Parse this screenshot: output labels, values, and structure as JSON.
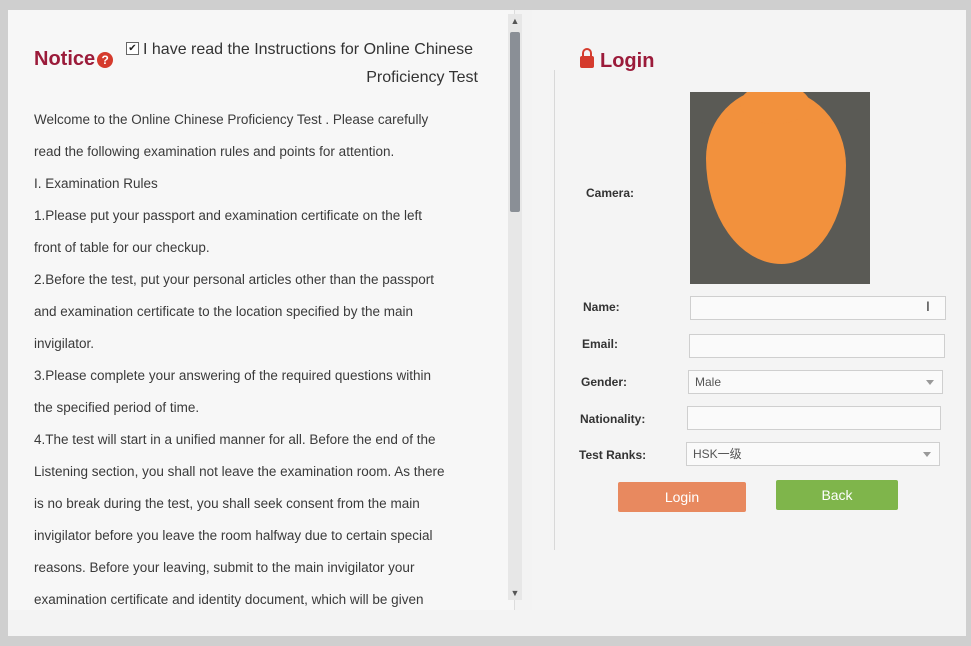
{
  "notice": {
    "title": "Notice",
    "agree_line1": "I have read the Instructions for Online Chinese",
    "agree_line2": "Proficiency Test",
    "agree_checked": true
  },
  "rules": [
    "Welcome to the Online Chinese Proficiency Test . Please carefully",
    "read the following examination rules and points for attention.",
    "I. Examination Rules",
    "1.Please put your passport and examination certificate on the left",
    "front of table for our checkup.",
    "2.Before the test, put your personal articles other than the passport",
    "and examination certificate to the location specified by the main",
    "invigilator.",
    "3.Please complete your answering of the required questions within",
    "the specified period of time.",
    "4.The test will start in a unified manner for all. Before the end of the",
    "Listening section, you shall not leave the examination room. As there",
    "is no break during the test, you shall seek consent from the main",
    "invigilator before you leave the room halfway due to certain special",
    "reasons. Before your leaving, submit to the main invigilator your",
    "examination certificate and identity document, which will be given"
  ],
  "login": {
    "title": "Login",
    "labels": {
      "camera": "Camera:",
      "name": "Name:",
      "email": "Email:",
      "gender": "Gender:",
      "nationality": "Nationality:",
      "test_ranks": "Test Ranks:"
    },
    "values": {
      "name": "",
      "email": "",
      "gender": "Male",
      "nationality": "",
      "test_ranks": "HSK一级"
    },
    "buttons": {
      "login": "Login",
      "back": "Back"
    }
  },
  "colors": {
    "title": "#9b1b3a",
    "login_button": "#e8895f",
    "back_button": "#7fb54b"
  }
}
